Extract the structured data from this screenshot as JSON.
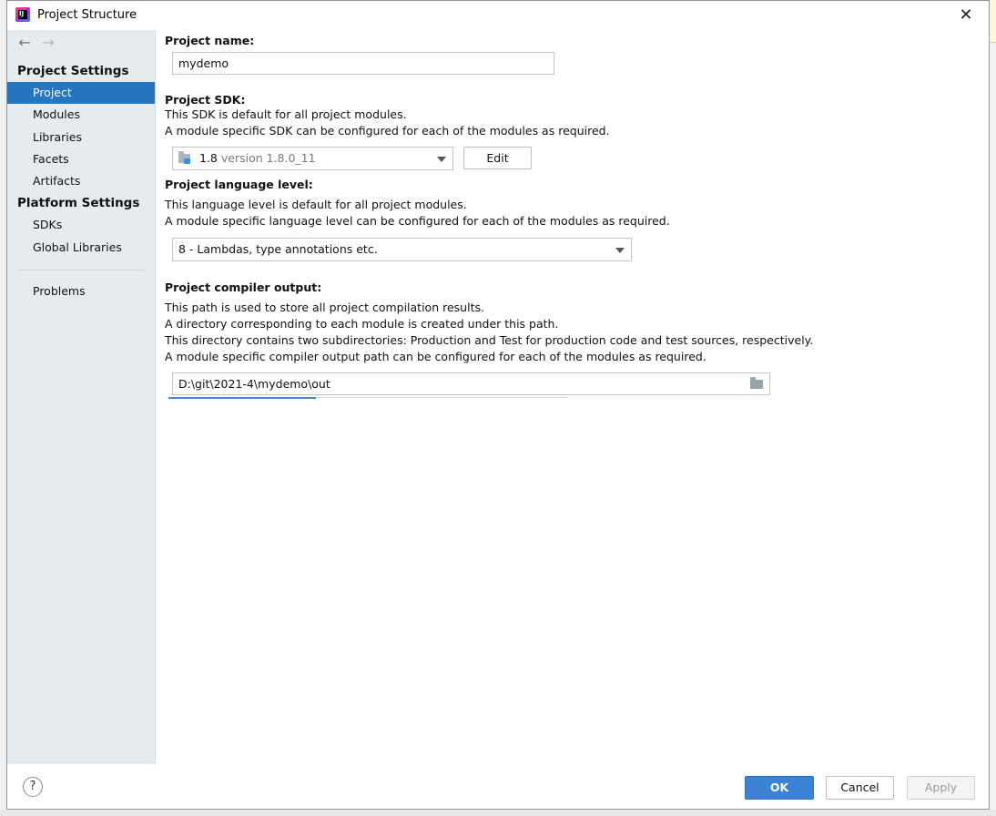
{
  "window": {
    "title": "Project Structure",
    "icon": "intellij-idea-icon",
    "close_symbol": "✕"
  },
  "navigation": {
    "back_symbol": "←",
    "forward_symbol": "→"
  },
  "sidebar": {
    "groups": [
      {
        "title": "Project Settings",
        "items": [
          "Project",
          "Modules",
          "Libraries",
          "Facets",
          "Artifacts"
        ]
      },
      {
        "title": "Platform Settings",
        "items": [
          "SDKs",
          "Global Libraries"
        ]
      }
    ],
    "problems": "Problems",
    "selected": "Project"
  },
  "project": {
    "name_label": "Project name:",
    "name_value": "mydemo",
    "sdk_label": "Project SDK:",
    "sdk_desc_1": "This SDK is default for all project modules.",
    "sdk_desc_2": "A module specific SDK can be configured for each of the modules as required.",
    "sdk_name": "1.8",
    "sdk_version": "version 1.8.0_11",
    "edit_button": "Edit",
    "language_label": "Project language level:",
    "language_desc_1": "This language level is default for all project modules.",
    "language_desc_2": "A module specific language level can be configured for each of the modules as required.",
    "language_value": "8 - Lambdas, type annotations etc.",
    "compiler_label": "Project compiler output:",
    "compiler_desc_1": "This path is used to store all project compilation results.",
    "compiler_desc_2": "A directory corresponding to each module is created under this path.",
    "compiler_desc_3": "This directory contains two subdirectories: Production and Test for production code and test sources, respectively.",
    "compiler_desc_4": "A module specific compiler output path can be configured for each of the modules as required.",
    "compiler_value": "D:\\git\\2021-4\\mydemo\\out"
  },
  "footer": {
    "help_symbol": "?",
    "ok": "OK",
    "cancel": "Cancel",
    "apply": "Apply"
  },
  "colors": {
    "selection": "#2675bf",
    "primary_button": "#3c83d6",
    "sidebar_bg": "#e6ebf0"
  }
}
